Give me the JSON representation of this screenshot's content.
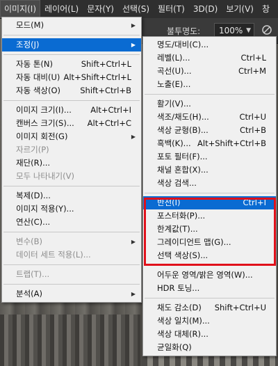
{
  "menubar": {
    "items": [
      "이미지(I)",
      "레이어(L)",
      "문자(Y)",
      "선택(S)",
      "필터(T)",
      "3D(D)",
      "보기(V)",
      "창"
    ]
  },
  "options": {
    "label": "불투명도:",
    "value": "100%",
    "brush_icon": "brush-icon"
  },
  "image_menu": {
    "items": [
      {
        "label": "모드(M)",
        "submenu": true
      },
      {
        "sep": true
      },
      {
        "label": "조정(J)",
        "submenu": true,
        "highlight": true
      },
      {
        "sep": true
      },
      {
        "label": "자동 톤(N)",
        "shortcut": "Shift+Ctrl+L"
      },
      {
        "label": "자동 대비(U)",
        "shortcut": "Alt+Shift+Ctrl+L"
      },
      {
        "label": "자동 색상(O)",
        "shortcut": "Shift+Ctrl+B"
      },
      {
        "sep": true
      },
      {
        "label": "이미지 크기(I)...",
        "shortcut": "Alt+Ctrl+I"
      },
      {
        "label": "캔버스 크기(S)...",
        "shortcut": "Alt+Ctrl+C"
      },
      {
        "label": "이미지 회전(G)",
        "submenu": true
      },
      {
        "label": "자르기(P)",
        "disabled": true
      },
      {
        "label": "재단(R)..."
      },
      {
        "label": "모두 나타내기(V)",
        "disabled": true
      },
      {
        "sep": true
      },
      {
        "label": "복제(D)..."
      },
      {
        "label": "이미지 적용(Y)..."
      },
      {
        "label": "연산(C)..."
      },
      {
        "sep": true
      },
      {
        "label": "변수(B)",
        "submenu": true,
        "disabled": true
      },
      {
        "label": "데이터 세트 적용(L)...",
        "disabled": true
      },
      {
        "sep": true
      },
      {
        "label": "트랩(T)...",
        "disabled": true
      },
      {
        "sep": true
      },
      {
        "label": "분석(A)",
        "submenu": true
      }
    ]
  },
  "adjust_menu": {
    "items": [
      {
        "label": "명도/대비(C)..."
      },
      {
        "label": "레벨(L)...",
        "shortcut": "Ctrl+L"
      },
      {
        "label": "곡선(U)...",
        "shortcut": "Ctrl+M"
      },
      {
        "label": "노출(E)..."
      },
      {
        "sep": true
      },
      {
        "label": "활기(V)..."
      },
      {
        "label": "색조/채도(H)...",
        "shortcut": "Ctrl+U"
      },
      {
        "label": "색상 균형(B)...",
        "shortcut": "Ctrl+B"
      },
      {
        "label": "흑백(K)...",
        "shortcut": "Alt+Shift+Ctrl+B"
      },
      {
        "label": "포토 필터(F)..."
      },
      {
        "label": "채널 혼합(X)..."
      },
      {
        "label": "색상 검색..."
      },
      {
        "sep": true
      },
      {
        "label": "반전(I)",
        "shortcut": "Ctrl+I",
        "highlight": true
      },
      {
        "label": "포스터화(P)..."
      },
      {
        "label": "한계값(T)..."
      },
      {
        "label": "그레이디언트 맵(G)..."
      },
      {
        "label": "선택 색상(S)..."
      },
      {
        "sep": true
      },
      {
        "label": "어두운 영역/밝은 영역(W)..."
      },
      {
        "label": "HDR 토닝..."
      },
      {
        "sep": true
      },
      {
        "label": "채도 감소(D)",
        "shortcut": "Shift+Ctrl+U"
      },
      {
        "label": "색상 일치(M)..."
      },
      {
        "label": "색상 대체(R)..."
      },
      {
        "label": "균일화(Q)"
      }
    ]
  },
  "colors": {
    "highlight": "#0a6bd2",
    "annotation": "#e0101a"
  }
}
